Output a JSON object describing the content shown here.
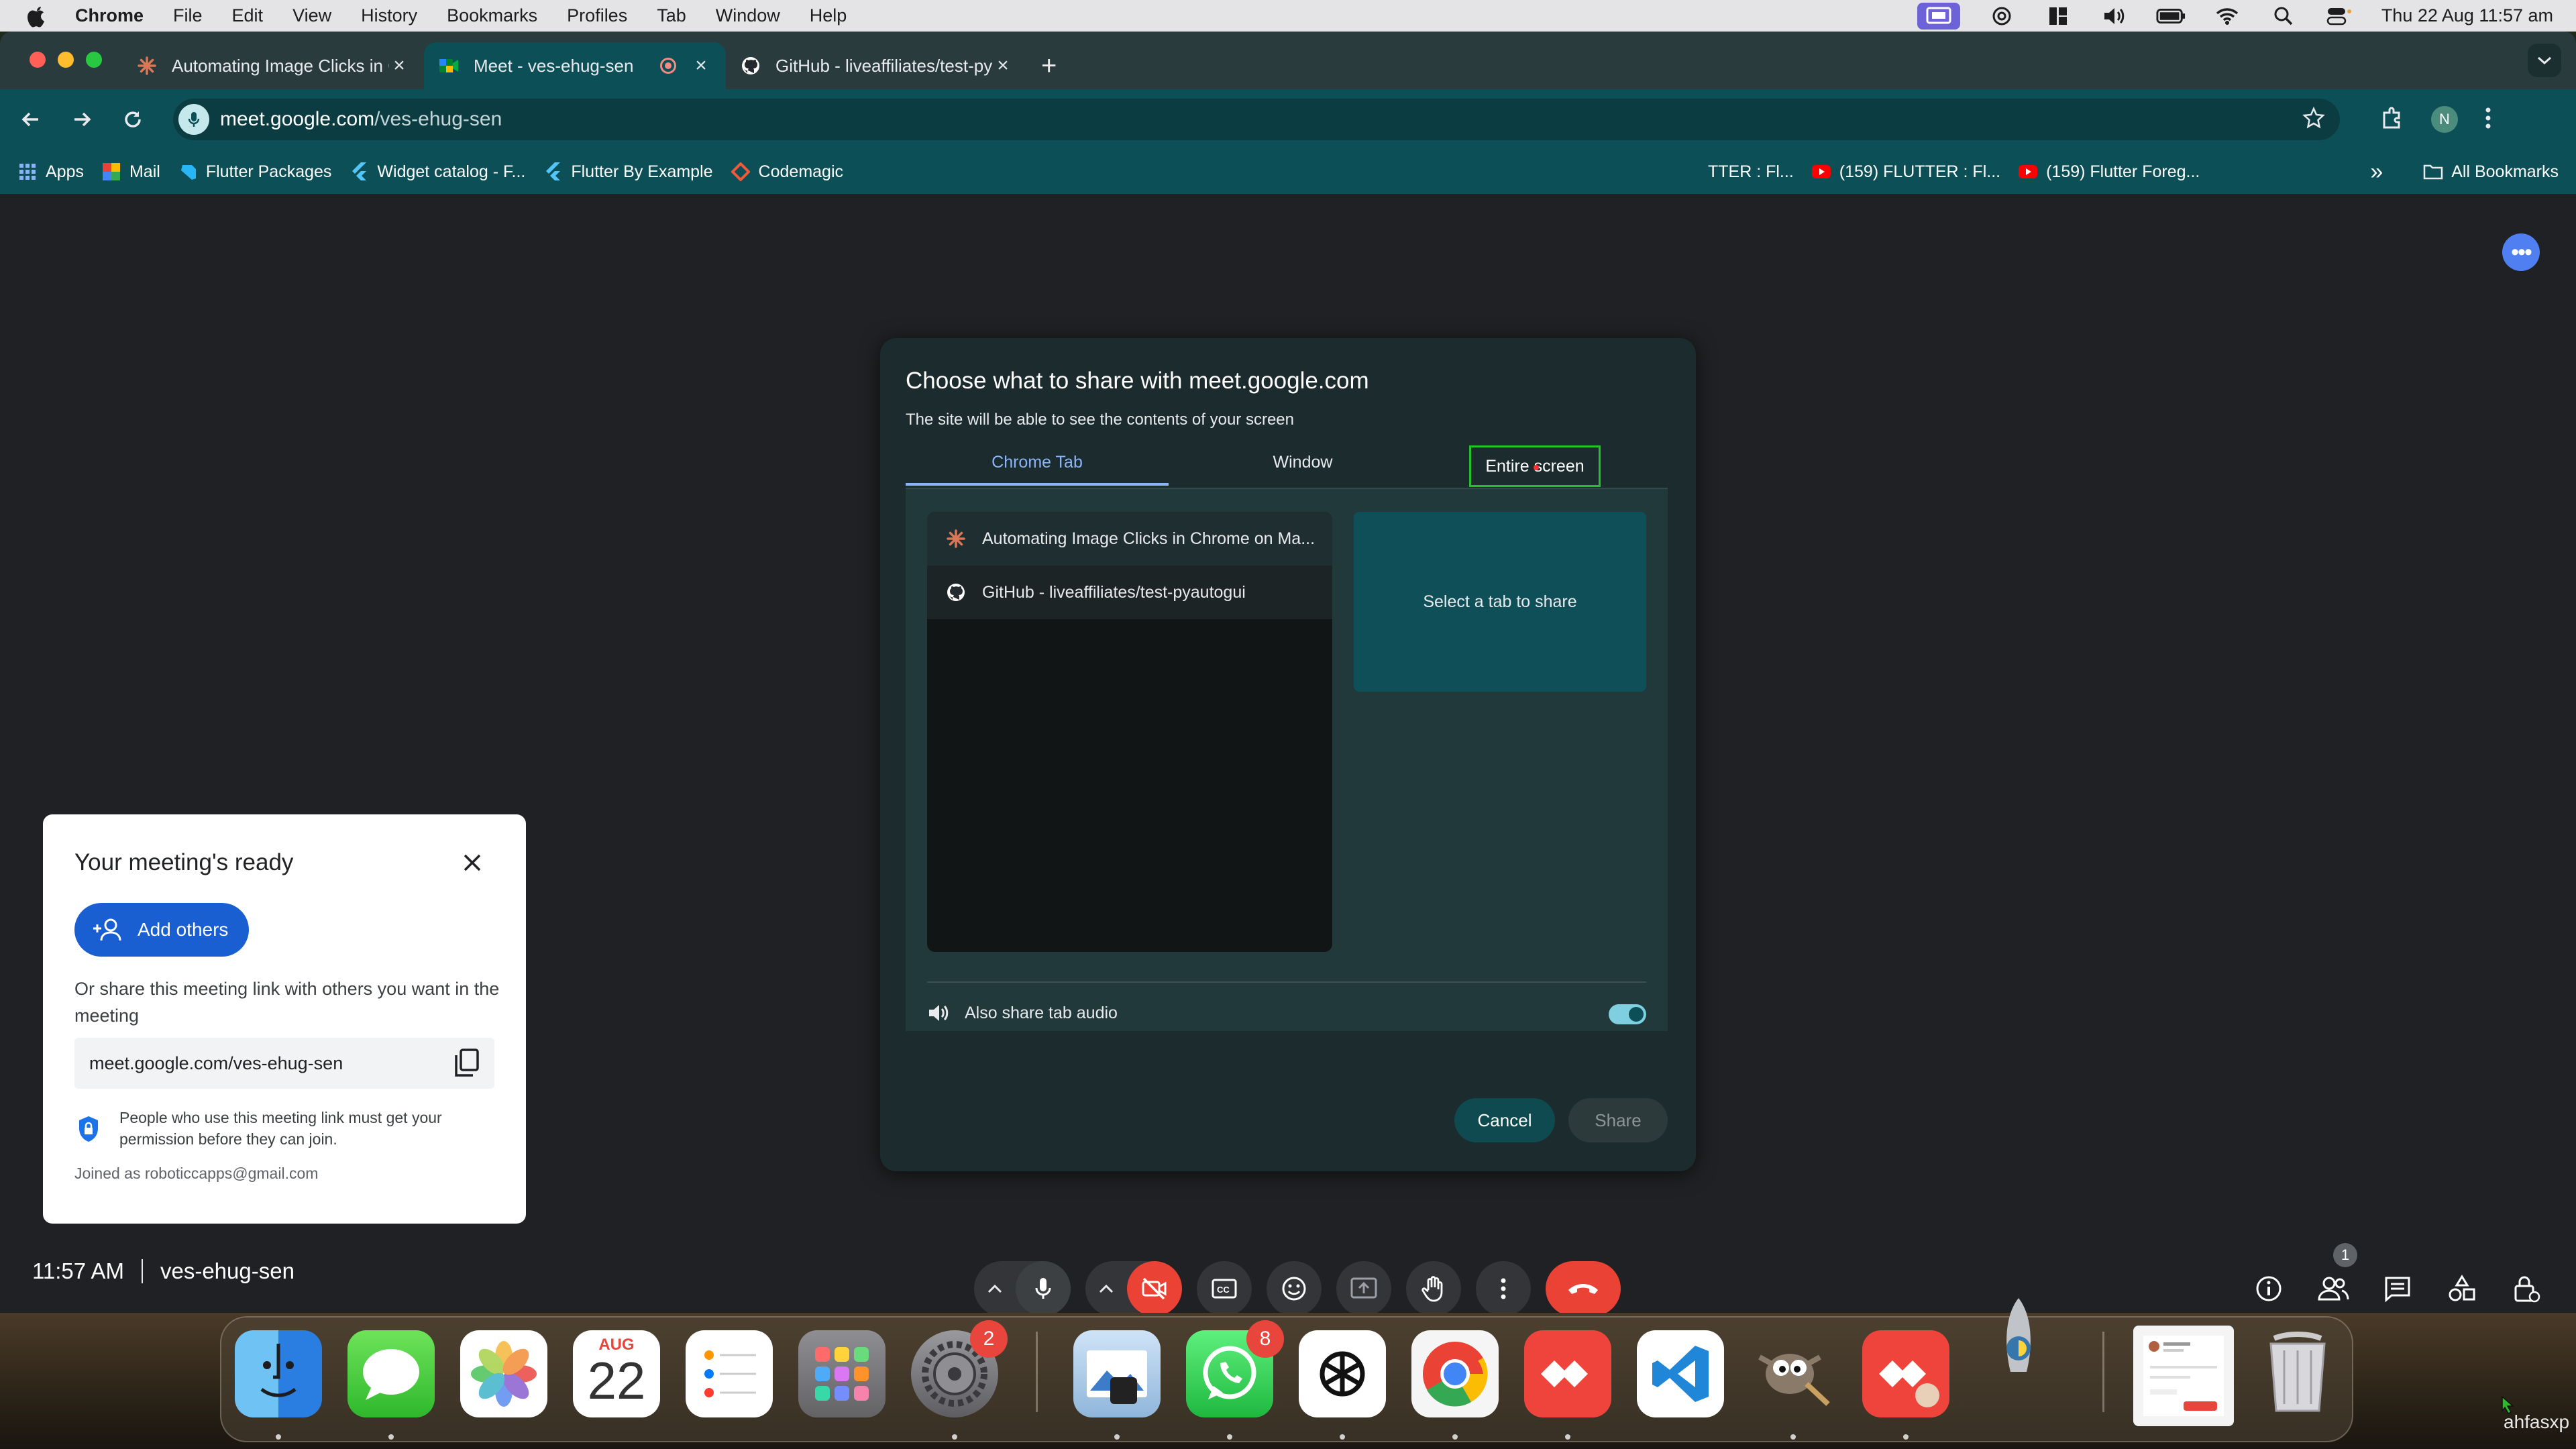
{
  "menubar": {
    "app": "Chrome",
    "items": [
      "File",
      "Edit",
      "View",
      "History",
      "Bookmarks",
      "Profiles",
      "Tab",
      "Window",
      "Help"
    ],
    "clock": "Thu 22 Aug  11:57 am"
  },
  "tabs": [
    {
      "title": "Automating Image Clicks in Chrome",
      "icon": "claude-icon"
    },
    {
      "title": "Meet - ves-ehug-sen",
      "icon": "meet-icon"
    },
    {
      "title": "GitHub - liveaffiliates/test-pyautogui",
      "icon": "github-icon"
    }
  ],
  "omnibox": {
    "host": "meet.google.com",
    "path": "/ves-ehug-sen"
  },
  "bookmarks": {
    "items": [
      "Apps",
      "Mail",
      "Flutter Packages",
      "Widget catalog - F...",
      "Flutter By Example",
      "Codemagic"
    ],
    "right_items": [
      "TTER : Fl...",
      "(159) FLUTTER : Fl...",
      "(159) Flutter Foreg..."
    ],
    "all": "All Bookmarks",
    "overflow": "»"
  },
  "dialog": {
    "title": "Choose what to share with meet.google.com",
    "subtitle": "The site will be able to see the contents of your screen",
    "tabs": [
      "Chrome Tab",
      "Window",
      "Entire screen"
    ],
    "list": [
      "Automating Image Clicks in Chrome on Ma...",
      "GitHub - liveaffiliates/test-pyautogui"
    ],
    "preview": "Select a tab to share",
    "audio_label": "Also share tab audio",
    "audio_on": true,
    "cancel": "Cancel",
    "share": "Share"
  },
  "ready_card": {
    "title": "Your meeting's ready",
    "add_others": "Add others",
    "desc": "Or share this meeting link with others you want in the meeting",
    "link": "meet.google.com/ves-ehug-sen",
    "permission_note": "People who use this meeting link must get your permission before they can join.",
    "joined": "Joined as roboticcapps@gmail.com"
  },
  "meeting": {
    "time": "11:57 AM",
    "code": "ves-ehug-sen",
    "participants": "1"
  },
  "dock": {
    "calendar_month": "AUG",
    "calendar_day": "22",
    "badges": {
      "settings": "2",
      "whatsapp": "8"
    }
  },
  "corner_label": "ahfasxp",
  "colors": {
    "accent": "#8ab4f8",
    "end_call": "#ea4335",
    "highlight": "#23c22a"
  }
}
